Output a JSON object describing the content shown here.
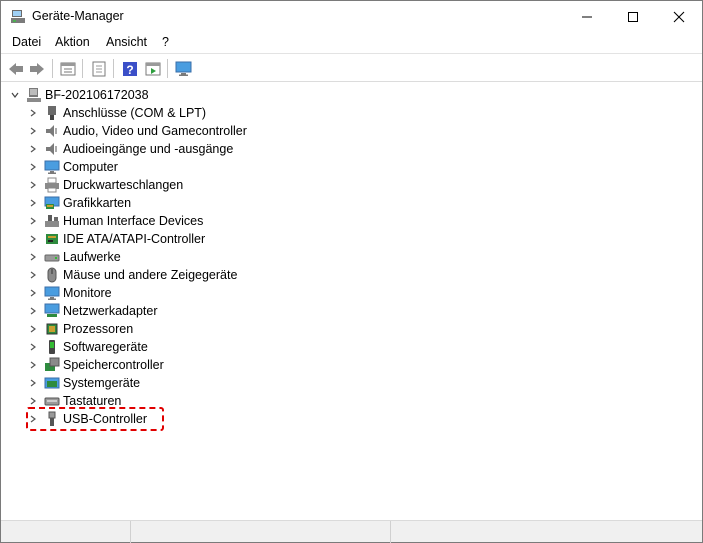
{
  "window": {
    "title": "Geräte-Manager"
  },
  "menu": [
    "Datei",
    "Aktion",
    "Ansicht",
    "?"
  ],
  "toolbar": {
    "buttons": [
      "back-arrow-icon",
      "forward-arrow-icon",
      "properties-icon",
      "update-driver-icon",
      "help-icon",
      "run-icon",
      "monitor-scan-icon"
    ]
  },
  "tree": {
    "root": "BF-202106172038",
    "nodes": [
      {
        "label": "Anschlüsse (COM & LPT)",
        "icon": "port-icon"
      },
      {
        "label": "Audio, Video und Gamecontroller",
        "icon": "speaker-icon"
      },
      {
        "label": "Audioeingänge und -ausgänge",
        "icon": "speaker-icon"
      },
      {
        "label": "Computer",
        "icon": "monitor-icon"
      },
      {
        "label": "Druckwarteschlangen",
        "icon": "printer-icon"
      },
      {
        "label": "Grafikkarten",
        "icon": "display-adapter-icon"
      },
      {
        "label": "Human Interface Devices",
        "icon": "hid-icon"
      },
      {
        "label": "IDE ATA/ATAPI-Controller",
        "icon": "ide-controller-icon"
      },
      {
        "label": "Laufwerke",
        "icon": "disk-drive-icon"
      },
      {
        "label": "Mäuse und andere Zeigegeräte",
        "icon": "mouse-icon"
      },
      {
        "label": "Monitore",
        "icon": "monitor-icon"
      },
      {
        "label": "Netzwerkadapter",
        "icon": "network-icon"
      },
      {
        "label": "Prozessoren",
        "icon": "cpu-icon"
      },
      {
        "label": "Softwaregeräte",
        "icon": "software-device-icon"
      },
      {
        "label": "Speichercontroller",
        "icon": "storage-controller-icon"
      },
      {
        "label": "Systemgeräte",
        "icon": "system-device-icon"
      },
      {
        "label": "Tastaturen",
        "icon": "keyboard-icon"
      },
      {
        "label": "USB-Controller",
        "icon": "usb-icon"
      }
    ]
  },
  "colors": {
    "highlight": "#e00000",
    "accent": "#2f7fd0"
  }
}
